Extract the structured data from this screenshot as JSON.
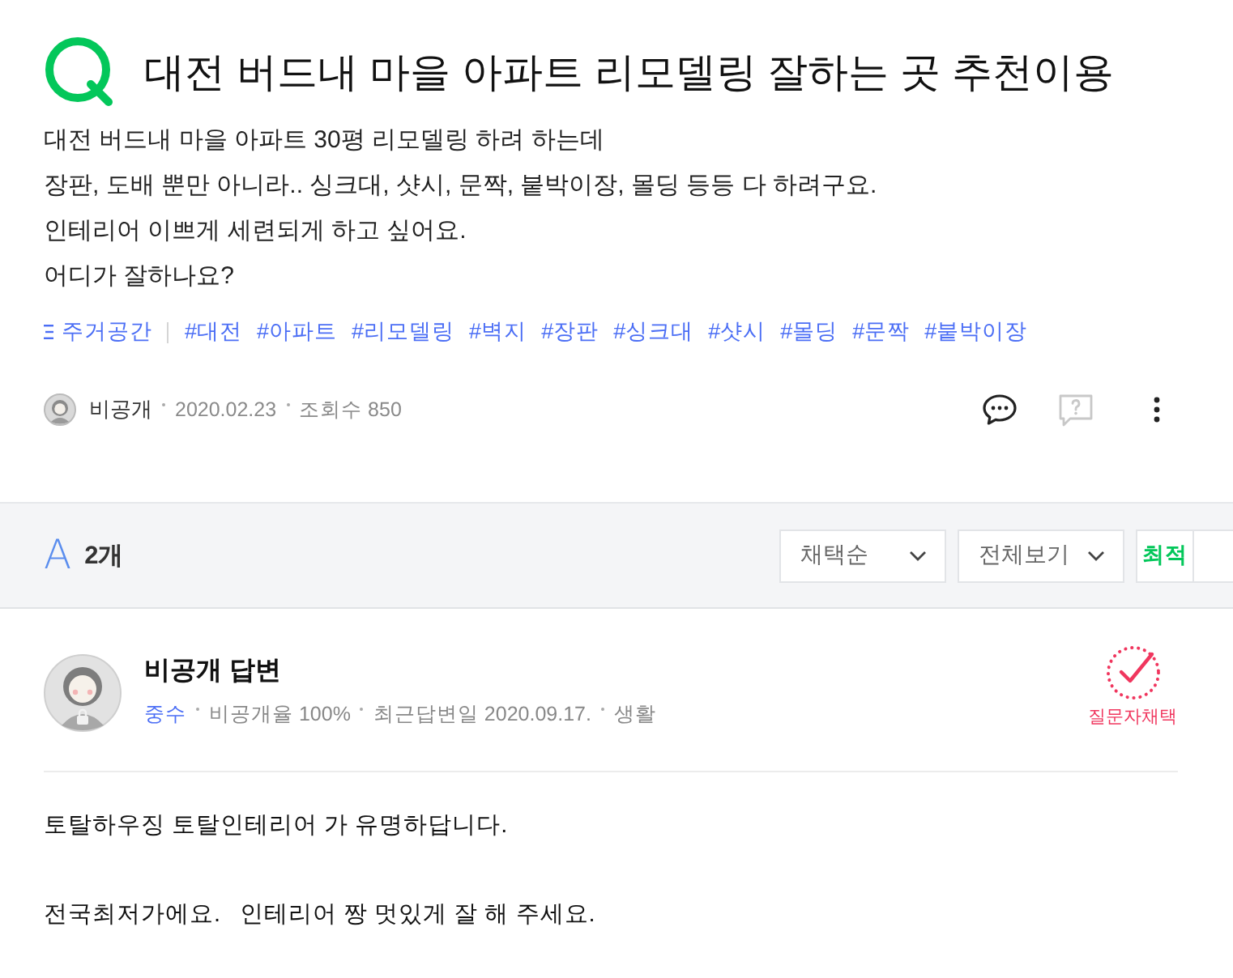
{
  "question": {
    "title": "대전 버드내 마을 아파트 리모델링 잘하는 곳 추천이용",
    "body": [
      "대전 버드내 마을 아파트 30평 리모델링 하려 하는데",
      "장판, 도배 뿐만 아니라.. 싱크대, 샷시, 문짝, 붙박이장, 몰딩 등등 다 하려구요.",
      "인테리어 이쁘게 세련되게 하고 싶어요.",
      "어디가 잘하나요?"
    ],
    "category": "주거공간",
    "tags": [
      "#대전",
      "#아파트",
      "#리모델링",
      "#벽지",
      "#장판",
      "#싱크대",
      "#샷시",
      "#몰딩",
      "#문짝",
      "#붙박이장"
    ]
  },
  "author": {
    "name": "비공개",
    "date": "2020.02.23",
    "views": "조회수 850"
  },
  "answers_bar": {
    "mark": "A",
    "count": "2개",
    "sort_dropdown": "채택순",
    "filter_dropdown": "전체보기",
    "toggle": [
      {
        "label": "최적",
        "selected": true
      }
    ]
  },
  "answer": {
    "author": "비공개 답변",
    "rank": "중수",
    "stats": [
      "비공개율 100%",
      "최근답변일 2020.09.17.",
      "생활"
    ],
    "badge": "질문자채택",
    "paragraphs": [
      "토탈하우징 토탈인테리어 가 유명하답니다.",
      "전국최저가에요.   인테리어 짱 멋있게 잘 해 주세요."
    ]
  }
}
